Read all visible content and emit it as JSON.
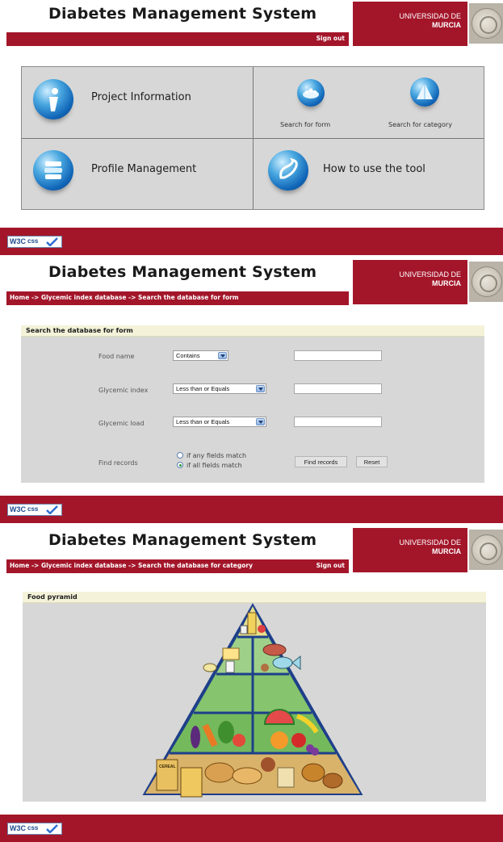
{
  "brand": {
    "system_title": "Diabetes Management System",
    "university_line1": "UNIVERSIDAD DE",
    "university_line2": "MURCIA",
    "accent_color": "#a3162a"
  },
  "footer": {
    "w3c_text": "W3C",
    "css_text": "css",
    "badge_icon": "w3c-css-validated-icon"
  },
  "screen1": {
    "signout": "Sign out",
    "cells": {
      "project_information": {
        "label": "Project Information",
        "icon": "info-icon"
      },
      "search_for_form": {
        "label": "Search for form",
        "icon": "search-form-icon"
      },
      "search_for_category": {
        "label": "Search for category",
        "icon": "pyramid-icon"
      },
      "profile_management": {
        "label": "Profile Management",
        "icon": "profile-stack-icon"
      },
      "how_to_use": {
        "label": "How to use the tool",
        "icon": "help-scroll-icon"
      }
    }
  },
  "screen2": {
    "breadcrumb": "Home -> Glycemic index database -> Search the database for form",
    "box_title": "Search the database for form",
    "fields": {
      "food_name": {
        "label": "Food name",
        "operator": "Contains",
        "value": ""
      },
      "glycemic_index": {
        "label": "Glycemic index",
        "operator": "Less than or Equals",
        "value": ""
      },
      "glycemic_load": {
        "label": "Glycemic load",
        "operator": "Less than or Equals",
        "value": ""
      }
    },
    "find_records_label": "Find records",
    "match_any": "if any fields match",
    "match_all": "if all fields match",
    "selected_match": "all",
    "find_button": "Find records",
    "reset_button": "Reset"
  },
  "screen3": {
    "breadcrumb": "Home -> Glycemic index database -> Search the database for category",
    "signout": "Sign out",
    "box_title": "Food pyramid",
    "cereal_label": "CEREAL",
    "pyramid_image": "food-pyramid-illustration"
  }
}
